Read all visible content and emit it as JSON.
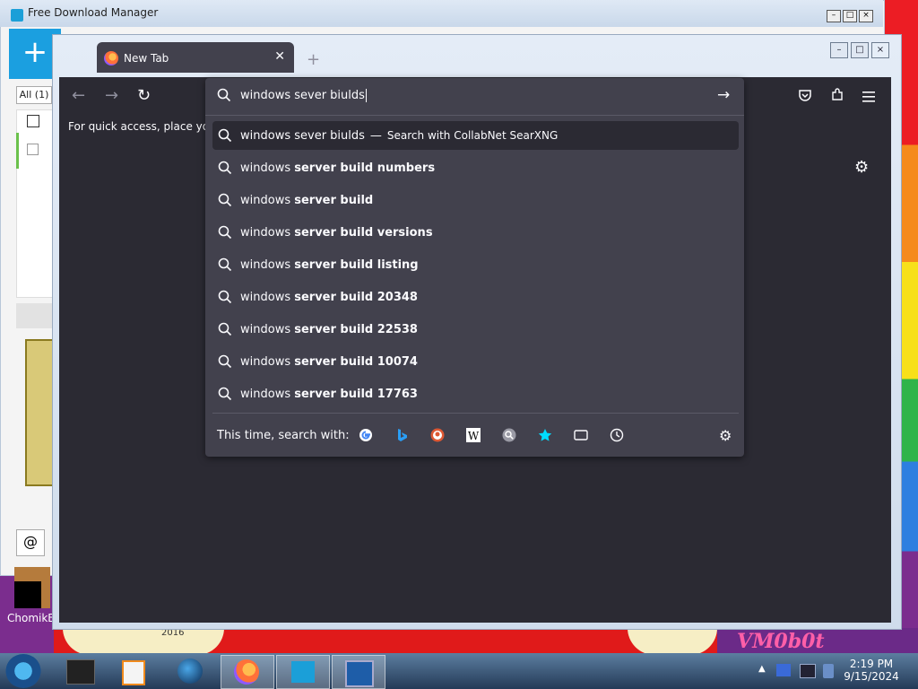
{
  "fdm": {
    "title": "Free Download Manager",
    "tab_all": "All (1)",
    "add_label": "+"
  },
  "desktop": {
    "icon_label": "ChomikB",
    "wallpaper_text": "VM0b0t",
    "wallpaper_year": "2016"
  },
  "firefox": {
    "tab_title": "New Tab",
    "new_tab_label": "+",
    "bookmarks_text": "For quick access, place your b",
    "url": {
      "value": "windows sever biulds",
      "selected": {
        "query": "windows sever biulds",
        "dash": "—",
        "action": "Search with CollabNet SearXNG"
      },
      "suggestions": [
        {
          "prefix": "windows ",
          "bold": "server build numbers"
        },
        {
          "prefix": "windows ",
          "bold": "server build"
        },
        {
          "prefix": "windows ",
          "bold": "server build versions"
        },
        {
          "prefix": "windows ",
          "bold": "server build listing"
        },
        {
          "prefix": "windows ",
          "bold": "server build 20348"
        },
        {
          "prefix": "windows ",
          "bold": "server build 22538"
        },
        {
          "prefix": "windows ",
          "bold": "server build 10074"
        },
        {
          "prefix": "windows ",
          "bold": "server build 17763"
        }
      ],
      "oneoff_label": "This time, search with:",
      "engines": [
        "google-icon",
        "bing-icon",
        "duckduckgo-icon",
        "wikipedia-icon",
        "searx-icon",
        "bookmarks-star-icon",
        "tabs-icon",
        "history-icon"
      ]
    }
  },
  "taskbar": {
    "time": "2:19 PM",
    "date": "9/15/2024"
  },
  "colors": {
    "ff_content": "#2b2a33",
    "ff_panel": "#42414d",
    "fdm_accent": "#1b9fe0"
  }
}
